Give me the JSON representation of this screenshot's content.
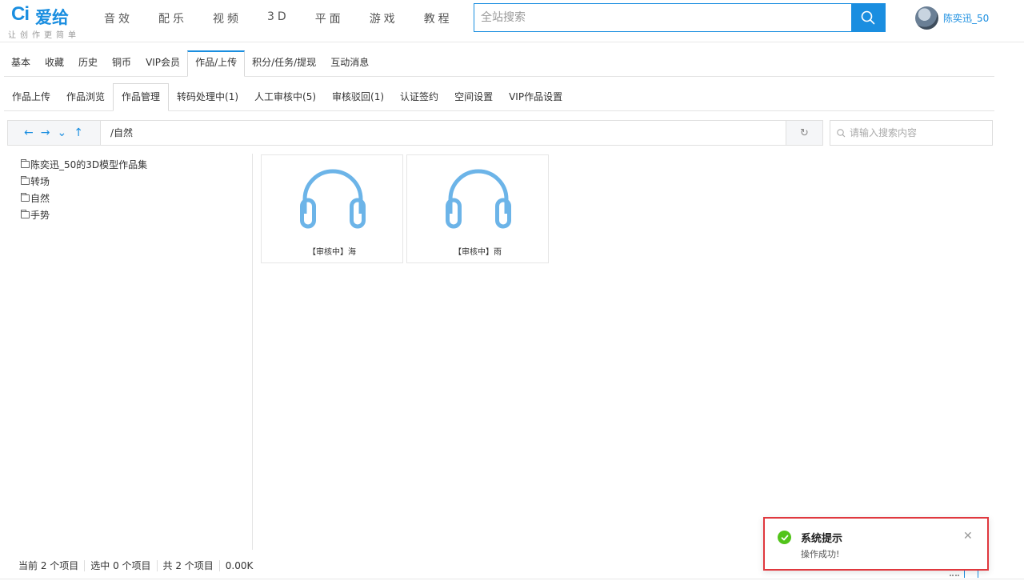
{
  "header": {
    "logo_mark": "Ci",
    "logo_text": "爱给",
    "slogan": "让创作更简单",
    "nav": [
      {
        "label": "音效"
      },
      {
        "label": "配乐"
      },
      {
        "label": "视频"
      },
      {
        "label": "3D"
      },
      {
        "label": "平面"
      },
      {
        "label": "游戏"
      },
      {
        "label": "教程"
      }
    ],
    "search_placeholder": "全站搜索",
    "user_name": "陈奕迅_50"
  },
  "tabs1": {
    "items": [
      "基本",
      "收藏",
      "历史",
      "铜币",
      "VIP会员",
      "作品/上传",
      "积分/任务/提现",
      "互动消息"
    ],
    "active": "作品/上传"
  },
  "tabs2": {
    "items": [
      "作品上传",
      "作品浏览",
      "作品管理",
      "转码处理中(1)",
      "人工审核中(5)",
      "审核驳回(1)",
      "认证签约",
      "空间设置",
      "VIP作品设置"
    ],
    "active": "作品管理"
  },
  "path": {
    "current": "/自然",
    "search_placeholder": "请输入搜索内容"
  },
  "tree": [
    {
      "label": "陈奕迅_50的3D模型作品集"
    },
    {
      "label": "转场"
    },
    {
      "label": "自然"
    },
    {
      "label": "手势"
    }
  ],
  "files": [
    {
      "name": "【审核中】海",
      "icon": "headphones-icon"
    },
    {
      "name": "【审核中】雨",
      "icon": "headphones-icon"
    }
  ],
  "status": {
    "current": "当前 2 个项目",
    "selected": "选中 0 个项目",
    "total": "共 2 个项目",
    "size": "0.00K"
  },
  "toast": {
    "title": "系统提示",
    "message": "操作成功!"
  },
  "colors": {
    "accent": "#1a8ee0",
    "success": "#52c41a",
    "highlight_border": "#e0383e",
    "icon_blue": "#6cb4e8"
  }
}
